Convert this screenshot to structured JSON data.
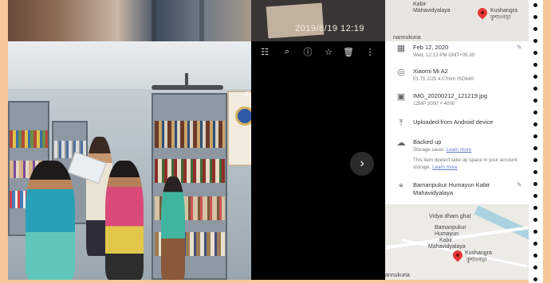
{
  "overlay": {
    "timestamp": "2019/8/19 12:19"
  },
  "viewer_toolbar": {
    "icons": [
      "tune-icon",
      "zoom-icon",
      "info-icon",
      "star-icon",
      "delete-icon",
      "more-icon"
    ]
  },
  "top_map": {
    "place_en": "Kushangra",
    "place_bn": "কুশাংগড়া",
    "area1": "Kabir",
    "area2": "Mahavidyalaya",
    "area3": "nannukuria"
  },
  "info": {
    "date": "Feb 12, 2020",
    "datetime": "Wed, 12:12 PM   GMT+05:30",
    "camera": "Xiaomi Mi A2",
    "camera_details": "f/1.75   1/25   4.07mm   ISO640",
    "filename": "IMG_20200212_121219.jpg",
    "file_details": "12MP   3000 × 4000",
    "uploaded": "Uploaded from Android device",
    "backup_title": "Backed up",
    "backup_saver": "Storage saver.",
    "backup_learn": "Learn more",
    "backup_note": "This item doesn't take up space in your account storage.",
    "backup_learn2": "Learn more",
    "location_line1": "Bamanpukur Humayun Kabir",
    "location_line2": "Mahavidyalaya"
  },
  "bottom_map": {
    "ghat": "Vidya dham ghat",
    "school1": "Bamanpukur",
    "school2": "Humayun",
    "school3": "Kabir",
    "school4": "Mahavidyalaya",
    "place_en": "Kushangra",
    "place_bn": "কুশাংগড়া",
    "area": "annukuria"
  },
  "colors": {
    "accent_link": "#5f7ec9",
    "pin": "#e53935",
    "frame": "#f6c79a"
  }
}
